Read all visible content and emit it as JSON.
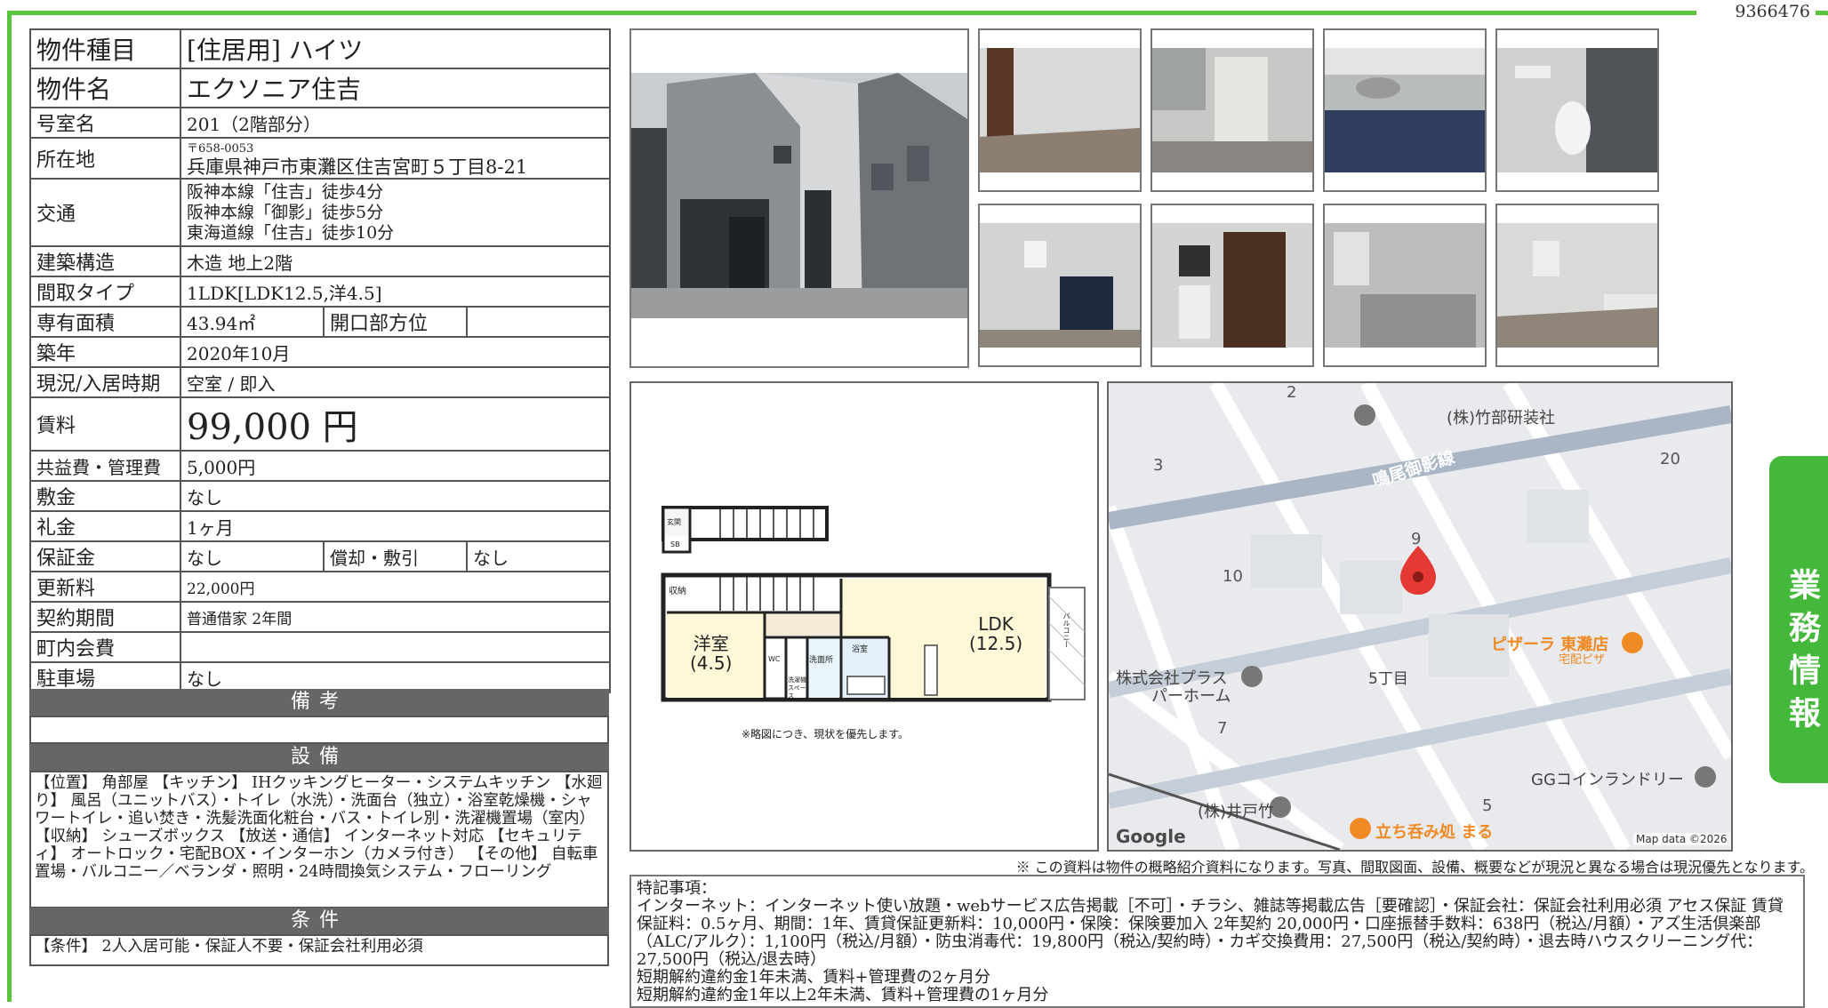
{
  "property_id": "9366476",
  "side_tab": "業務情報",
  "info": {
    "type_label": "物件種目",
    "type_value": "[住居用] ハイツ",
    "name_label": "物件名",
    "name_value": "エクソニア住吉",
    "room_label": "号室名",
    "room_value": "201（2階部分）",
    "address_label": "所在地",
    "postal": "〒658-0053",
    "address": "兵庫県神戸市東灘区住吉宮町５丁目8-21",
    "transit_label": "交通",
    "transit": [
      "阪神本線「住吉」徒歩4分",
      "阪神本線「御影」徒歩5分",
      "東海道線「住吉」徒歩10分"
    ],
    "structure_label": "建築構造",
    "structure_value": "木造 地上2階",
    "layout_label": "間取タイプ",
    "layout_value": "1LDK[LDK12.5,洋4.5]",
    "area_label": "専有面積",
    "area_value": "43.94㎡",
    "direction_label": "開口部方位",
    "direction_value": "",
    "built_label": "築年",
    "built_value": "2020年10月",
    "status_label": "現況/入居時期",
    "status_value": "空室 / 即入",
    "rent_label": "賃料",
    "rent_value": "99,000 円",
    "fee_label": "共益費・管理費",
    "fee_value": "5,000円",
    "deposit_label": "敷金",
    "deposit_value": "なし",
    "key_label": "礼金",
    "key_value": "1ヶ月",
    "guarantee_label": "保証金",
    "guarantee_value": "なし",
    "amort_label": "償却・敷引",
    "amort_value": "なし",
    "renewal_label": "更新料",
    "renewal_value": "22,000円",
    "contract_label": "契約期間",
    "contract_value": "普通借家 2年間",
    "community_label": "町内会費",
    "community_value": "",
    "parking_label": "駐車場",
    "parking_value": "なし"
  },
  "remarks_header": "備考",
  "facilities_header": "設備",
  "facilities_text": "【位置】 角部屋 【キッチン】 IHクッキングヒーター・システムキッチン 【水廻り】 風呂（ユニットバス）・トイレ（水洗）・洗面台（独立）・浴室乾燥機・シャワートイレ・追い焚き・洗髪洗面化粧台・バス・トイレ別・洗濯機置場（室内） 【収納】 シューズボックス 【放送・通信】 インターネット対応 【セキュリティ】 オートロック・宅配BOX・インターホン（カメラ付き） 【その他】 自転車置場・バルコニー／ベランダ・照明・24時間換気システム・フローリング",
  "conditions_header": "条件",
  "conditions_text": "【条件】 2人入居可能・保証人不要・保証会社利用必須",
  "floorplan": {
    "room1": "洋室",
    "room1_size": "(4.5)",
    "room2": "LDK",
    "room2_size": "(12.5)",
    "storage": "収納",
    "entrance": "玄関",
    "sb": "SB",
    "wc": "WC",
    "washroom": "洗面所",
    "bath": "浴室",
    "laundry": "洗濯機スペース",
    "balcony": "バルコニー",
    "note": "※略図につき、現状を優先します。"
  },
  "map": {
    "labels": [
      "2",
      "(株)竹部研装社",
      "3",
      "鳴尾御影線",
      "20",
      "9",
      "10",
      "ピザーラ 東灘店",
      "宅配ピザ",
      "株式会社プラス",
      "パーホーム",
      "5丁目",
      "7",
      "GGコインランドリー",
      "5",
      "(株)井戸竹",
      "立ち呑み処 まる"
    ],
    "google": "Google",
    "attribution": "Map data ©2026"
  },
  "footnote": "※ この資料は物件の概略紹介資料になります。写真、間取図面、設備、概要などが現況と異なる場合は現況優先となります。",
  "special_notes": {
    "title": "特記事項：",
    "line1": "インターネット：インターネット使い放題・webサービス広告掲載［不可］・チラシ、雑誌等掲載広告［要確認］・保証会社：保証会社利用必須 アセス保証 賃貸保証料：0.5ヶ月、期間：1年、賃貸保証更新料：10,000円・保険：保険要加入 2年契約 20,000円・口座振替手数料：638円（税込/月額）・アズ生活倶楽部（ALC/アルク）：1,100円（税込/月額）・防虫消毒代：19,800円（税込/契約時）・カギ交換費用：27,500円（税込/契約時）・退去時ハウスクリーニング代：27,500円（税込/退去時）",
    "line2": "短期解約違約金1年未満、賃料+管理費の2ヶ月分",
    "line3": "短期解約違約金1年以上2年未満、賃料+管理費の1ヶ月分"
  },
  "colors": {
    "accent": "#44b83a",
    "header_gray": "#666666",
    "pin": "#e53935",
    "poi_orange": "#f08a24"
  }
}
